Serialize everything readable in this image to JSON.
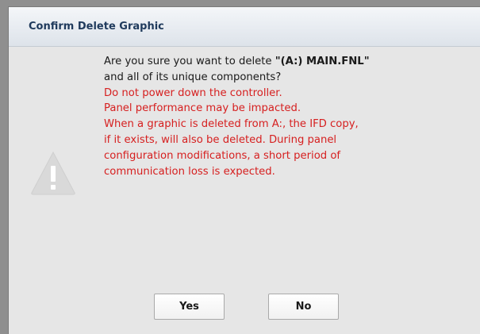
{
  "dialog": {
    "title": "Confirm Delete Graphic",
    "icon": "warning-triangle-icon",
    "message": {
      "line1_prefix": "Are you sure you want to delete ",
      "line1_filename": "\"(A:) MAIN.FNL\"",
      "line2": "and all of its unique components?",
      "warnings": [
        "Do not power down the controller.",
        "Panel performance may be impacted.",
        "When a graphic is deleted from A:, the IFD copy,",
        "if it exists, will also be deleted. During panel",
        "configuration modifications, a short period of",
        "communication loss is expected."
      ]
    },
    "buttons": {
      "yes": "Yes",
      "no": "No"
    },
    "colors": {
      "warning_text": "#d61f1f",
      "title_text": "#1f3a5c",
      "background": "#e6e6e6"
    }
  }
}
